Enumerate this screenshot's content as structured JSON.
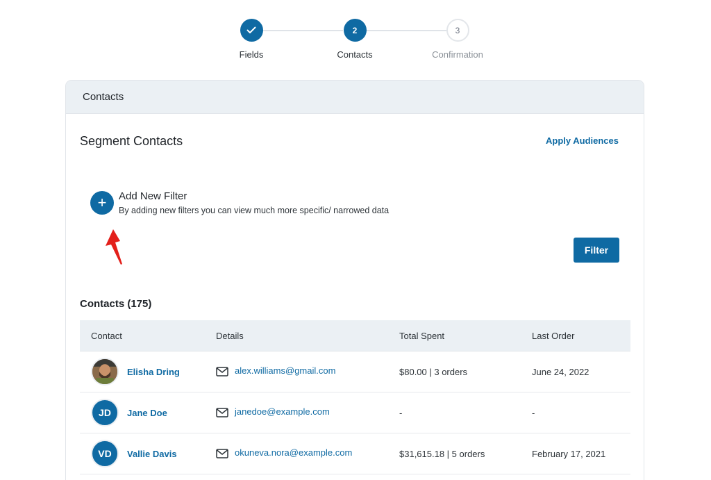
{
  "stepper": {
    "steps": [
      {
        "number": "",
        "label": "Fields",
        "state": "done"
      },
      {
        "number": "2",
        "label": "Contacts",
        "state": "active"
      },
      {
        "number": "3",
        "label": "Confirmation",
        "state": "pending"
      }
    ]
  },
  "card": {
    "header": "Contacts",
    "segment_title": "Segment Contacts",
    "apply_audiences": "Apply Audiences",
    "add_filter": {
      "icon": "+",
      "title": "Add New Filter",
      "description": "By adding new filters you can view much more specific/ narrowed data"
    },
    "filter_button": "Filter",
    "contacts_count": "Contacts (175)"
  },
  "table": {
    "columns": [
      "Contact",
      "Details",
      "Total Spent",
      "Last Order"
    ],
    "rows": [
      {
        "initials": "",
        "avatar": "photo",
        "name": "Elisha Dring",
        "email": "alex.williams@gmail.com",
        "total": "$80.00 | 3 orders",
        "last_order": "June 24, 2022"
      },
      {
        "initials": "JD",
        "avatar": "initials",
        "name": "Jane Doe",
        "email": "janedoe@example.com",
        "total": "-",
        "last_order": "-"
      },
      {
        "initials": "VD",
        "avatar": "initials",
        "name": "Vallie Davis",
        "email": "okuneva.nora@example.com",
        "total": "$31,615.18 | 5 orders",
        "last_order": "February 17, 2021"
      }
    ]
  },
  "colors": {
    "accent": "#0f6aa3",
    "header_bg": "#ebf0f4",
    "arrow": "#e3201b"
  }
}
